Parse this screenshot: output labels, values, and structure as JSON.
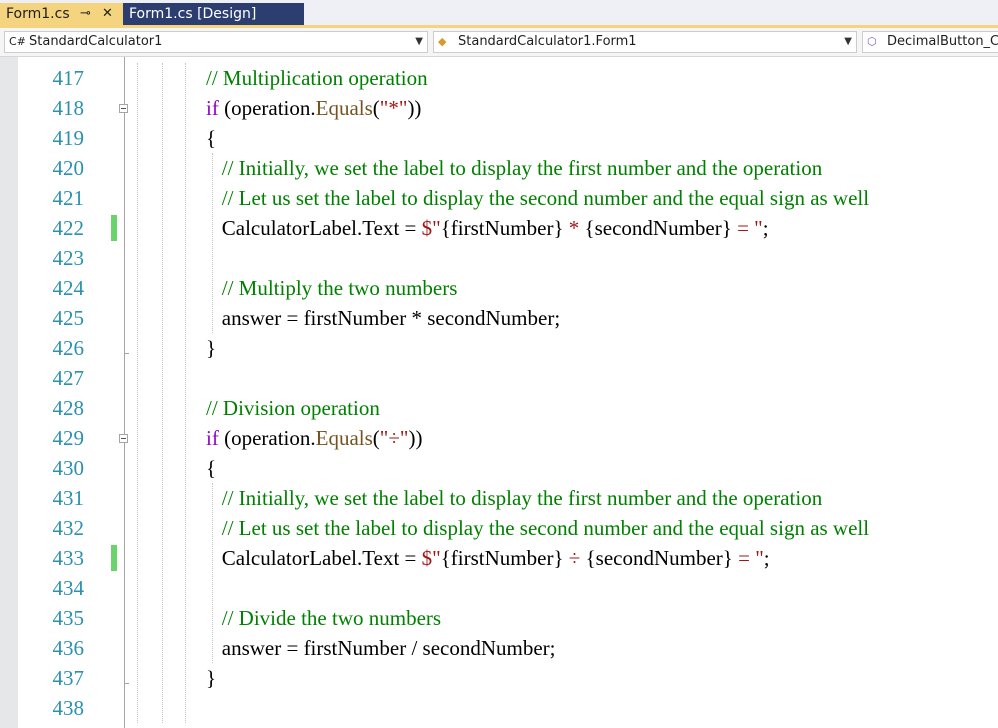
{
  "tabs": [
    {
      "label": "Form1.cs",
      "pin_icon": "pin-icon",
      "close_icon": "close-icon"
    },
    {
      "label": "Form1.cs [Design]"
    }
  ],
  "nav": {
    "project": {
      "icon_text": "C#",
      "label": "StandardCalculator1"
    },
    "class": {
      "label": "StandardCalculator1.Form1"
    },
    "member": {
      "label": "DecimalButton_C"
    }
  },
  "colors": {
    "line_number": "#2b91af",
    "comment": "#008000",
    "keyword": "#8f08c4",
    "method": "#74531f",
    "string": "#a31515",
    "change_marker": "#6bd36b",
    "active_tab": "#f4d47e",
    "inactive_tab": "#2c3d70"
  },
  "lines": [
    {
      "num": "417",
      "parts": [
        [
          "cmt",
          "// Multiplication operation"
        ]
      ]
    },
    {
      "num": "418",
      "parts": [
        [
          "kw",
          "if"
        ],
        [
          "pl",
          " (operation."
        ],
        [
          "mth",
          "Equals"
        ],
        [
          "pl",
          "("
        ],
        [
          "str",
          "\"*\""
        ],
        [
          "pl",
          "))"
        ]
      ]
    },
    {
      "num": "419",
      "parts": [
        [
          "pl",
          "{"
        ]
      ]
    },
    {
      "num": "420",
      "parts": [
        [
          "pl",
          "   "
        ],
        [
          "cmt",
          "// Initially, we set the label to display the first number and the operation"
        ]
      ]
    },
    {
      "num": "421",
      "parts": [
        [
          "pl",
          "   "
        ],
        [
          "cmt",
          "// Let us set the label to display the second number and the equal sign as well"
        ]
      ]
    },
    {
      "num": "422",
      "parts": [
        [
          "pl",
          "   CalculatorLabel.Text = "
        ],
        [
          "str",
          "$\""
        ],
        [
          "pl",
          "{firstNumber}"
        ],
        [
          "str",
          " * "
        ],
        [
          "pl",
          "{secondNumber}"
        ],
        [
          "str",
          " = \""
        ],
        [
          "pl",
          ";"
        ]
      ]
    },
    {
      "num": "423",
      "parts": []
    },
    {
      "num": "424",
      "parts": [
        [
          "pl",
          "   "
        ],
        [
          "cmt",
          "// Multiply the two numbers"
        ]
      ]
    },
    {
      "num": "425",
      "parts": [
        [
          "pl",
          "   answer = firstNumber * secondNumber;"
        ]
      ]
    },
    {
      "num": "426",
      "parts": [
        [
          "pl",
          "}"
        ]
      ]
    },
    {
      "num": "427",
      "parts": []
    },
    {
      "num": "428",
      "parts": [
        [
          "cmt",
          "// Division operation"
        ]
      ]
    },
    {
      "num": "429",
      "parts": [
        [
          "kw",
          "if"
        ],
        [
          "pl",
          " (operation."
        ],
        [
          "mth",
          "Equals"
        ],
        [
          "pl",
          "("
        ],
        [
          "str",
          "\"÷\""
        ],
        [
          "pl",
          "))"
        ]
      ]
    },
    {
      "num": "430",
      "parts": [
        [
          "pl",
          "{"
        ]
      ]
    },
    {
      "num": "431",
      "parts": [
        [
          "pl",
          "   "
        ],
        [
          "cmt",
          "// Initially, we set the label to display the first number and the operation"
        ]
      ]
    },
    {
      "num": "432",
      "parts": [
        [
          "pl",
          "   "
        ],
        [
          "cmt",
          "// Let us set the label to display the second number and the equal sign as well"
        ]
      ]
    },
    {
      "num": "433",
      "parts": [
        [
          "pl",
          "   CalculatorLabel.Text = "
        ],
        [
          "str",
          "$\""
        ],
        [
          "pl",
          "{firstNumber}"
        ],
        [
          "str",
          " ÷ "
        ],
        [
          "pl",
          "{secondNumber}"
        ],
        [
          "str",
          " = \""
        ],
        [
          "pl",
          ";"
        ]
      ]
    },
    {
      "num": "434",
      "parts": []
    },
    {
      "num": "435",
      "parts": [
        [
          "pl",
          "   "
        ],
        [
          "cmt",
          "// Divide the two numbers"
        ]
      ]
    },
    {
      "num": "436",
      "parts": [
        [
          "pl",
          "   answer = firstNumber / secondNumber;"
        ]
      ]
    },
    {
      "num": "437",
      "parts": [
        [
          "pl",
          "}"
        ]
      ]
    },
    {
      "num": "438",
      "parts": []
    }
  ],
  "changed_lines": [
    "422",
    "433"
  ],
  "fold_lines": [
    "418",
    "429"
  ]
}
